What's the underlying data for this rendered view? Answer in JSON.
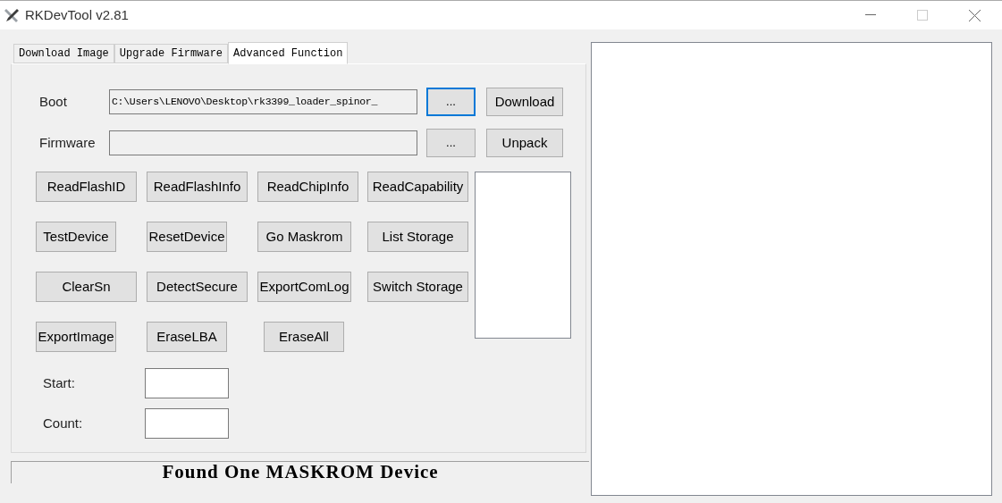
{
  "window": {
    "title": "RKDevTool v2.81"
  },
  "tabs": [
    {
      "label": "Download Image",
      "selected": false
    },
    {
      "label": "Upgrade Firmware",
      "selected": false
    },
    {
      "label": "Advanced Function",
      "selected": true
    }
  ],
  "file_rows": [
    {
      "label": "Boot",
      "value": "C:\\Users\\LENOVO\\Desktop\\rk3399_loader_spinor_",
      "browse": {
        "label": "...",
        "focused": true
      },
      "action": "Download"
    },
    {
      "label": "Firmware",
      "browse": {
        "label": "...",
        "focused": false
      },
      "action": "Unpack"
    }
  ],
  "buttons": [
    [
      "ReadFlashID",
      "ReadFlashInfo",
      "ReadChipInfo",
      "ReadCapability"
    ],
    [
      "TestDevice",
      "ResetDevice",
      "Go Maskrom",
      "List Storage"
    ],
    [
      "ClearSn",
      "DetectSecure",
      "ExportComLog",
      "Switch Storage"
    ],
    [
      "ExportImage",
      "EraseLBA",
      "EraseAll"
    ]
  ],
  "lba_fields": [
    {
      "label": "Start:"
    },
    {
      "label": "Count:"
    }
  ],
  "status": "Found One MASKROM Device"
}
